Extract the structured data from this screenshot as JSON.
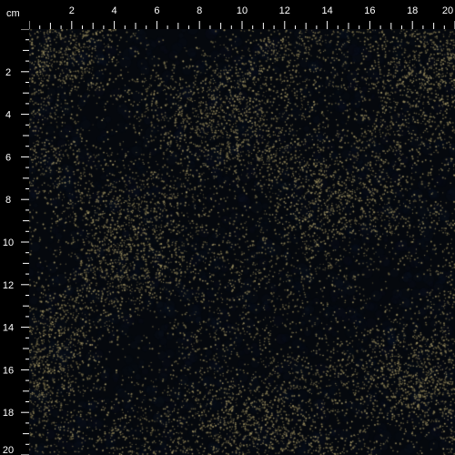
{
  "ruler": {
    "unit": "cm",
    "top_labels": [
      "2",
      "4",
      "6",
      "8",
      "10",
      "12",
      "14",
      "16",
      "18",
      "20"
    ],
    "left_labels": [
      "2",
      "4",
      "6",
      "8",
      "10",
      "12",
      "14",
      "16",
      "18",
      "20"
    ]
  },
  "colors": {
    "background": "#000000",
    "fabric_base": "#05080d",
    "dot_gold": "#8a7f55",
    "ruler_text": "#ffffff"
  }
}
